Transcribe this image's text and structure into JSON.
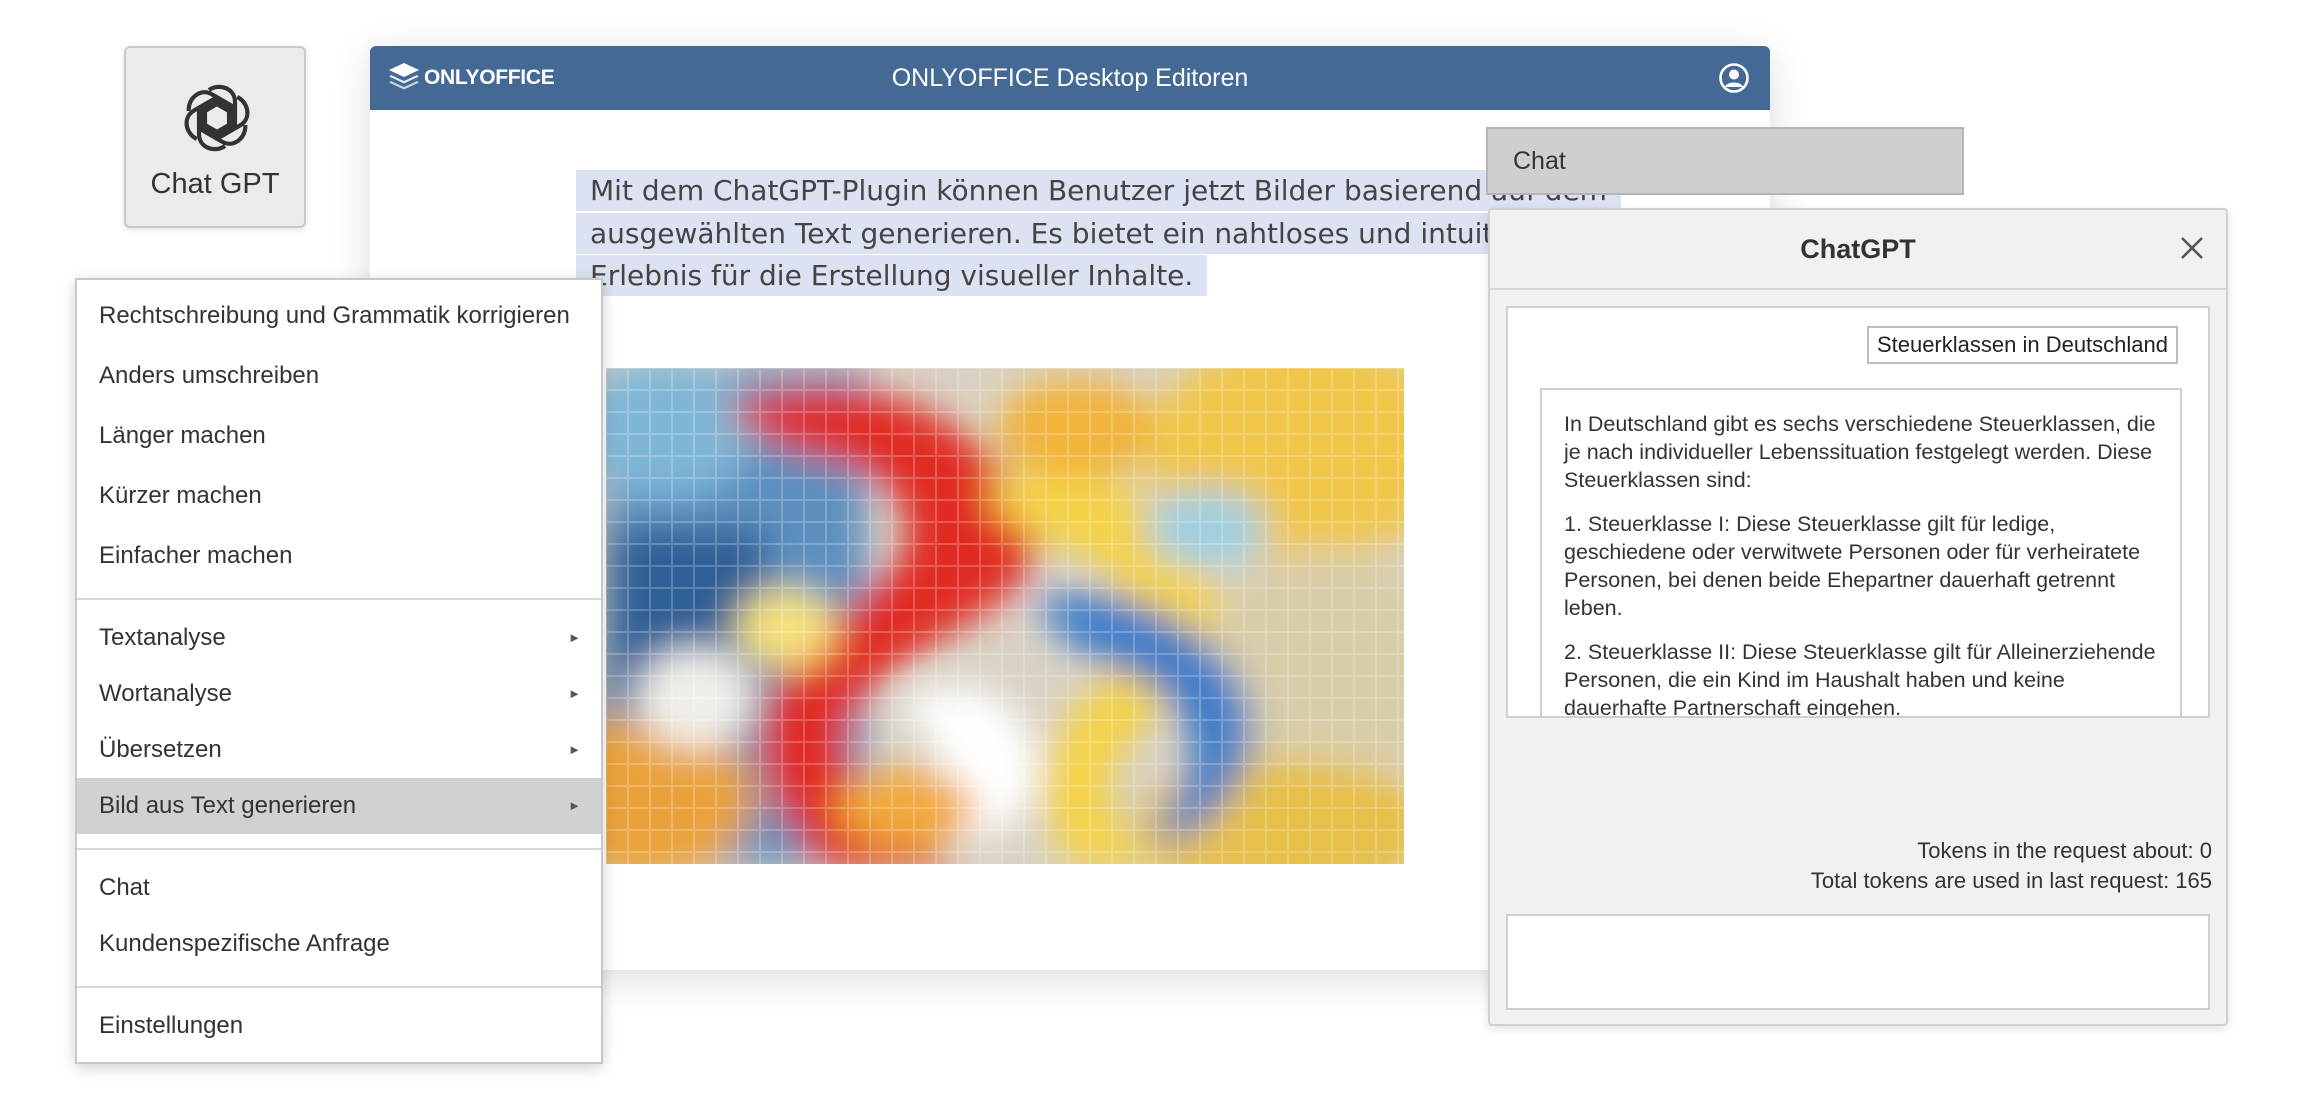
{
  "tile": {
    "label": "Chat GPT",
    "icon": "openai-logo-icon"
  },
  "editor": {
    "logo_text": "ONLYOFFICE",
    "title": "ONLYOFFICE Desktop Editoren",
    "selected_text": "Mit dem ChatGPT-Plugin können Benutzer jetzt Bilder basierend auf dem ausgewählten Text generieren. Es bietet ein nahtloses und intuitives Erlebnis für die Erstellung visueller Inhalte.",
    "highlight_color": "#dde2f3",
    "titlebar_color": "#446995"
  },
  "context_menu": {
    "items": [
      {
        "label": "Rechtschreibung und Grammatik korrigieren"
      },
      {
        "label": "Anders umschreiben"
      },
      {
        "label": "Länger machen"
      },
      {
        "label": "Kürzer machen"
      },
      {
        "label": "Einfacher machen"
      },
      {
        "label": "Textanalyse"
      },
      {
        "label": "Wortanalyse"
      },
      {
        "label": "Übersetzen"
      },
      {
        "label": "Bild aus Text generieren"
      },
      {
        "label": "Chat"
      },
      {
        "label": "Kundenspezifische Anfrage"
      },
      {
        "label": "Einstellungen"
      }
    ]
  },
  "chat_tab": {
    "label": "Chat"
  },
  "panel": {
    "title": "ChatGPT",
    "user_message": "Steuerklassen in Deutschland",
    "answer": [
      "In Deutschland gibt es sechs verschiedene Steuerklassen, die je nach individueller Lebenssituation festgelegt werden. Diese Steuerklassen sind:",
      "1. Steuerklasse I: Diese Steuerklasse gilt für ledige, geschiedene oder verwitwete Personen oder für verheiratete Personen, bei denen beide Ehepartner dauerhaft getrennt leben.",
      "2. Steuerklasse II: Diese Steuerklasse gilt für Alleinerziehende Personen, die ein Kind im Haushalt haben und keine dauerhafte Partnerschaft eingehen."
    ],
    "tokens_request": "Tokens in the request about: 0",
    "tokens_last": "Total tokens are used in last request: 165"
  }
}
